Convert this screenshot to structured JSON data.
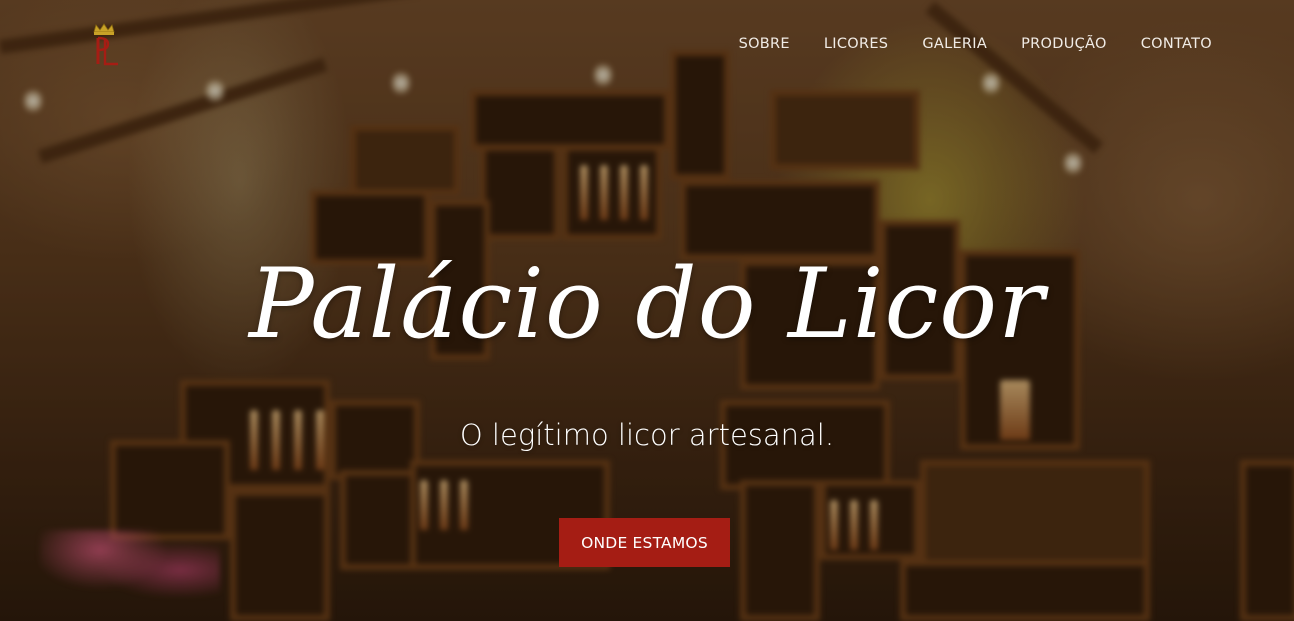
{
  "brand": {
    "logo_icon": "crown-pl-monogram-icon",
    "monogram_letters": "PL",
    "accent_color": "#a51d14"
  },
  "nav": {
    "items": [
      {
        "label": "SOBRE"
      },
      {
        "label": "LICORES"
      },
      {
        "label": "GALERIA"
      },
      {
        "label": "PRODUÇÃO"
      },
      {
        "label": "CONTATO"
      }
    ]
  },
  "hero": {
    "title": "Palácio do Licor",
    "subtitle": "O legítimo licor artesanal.",
    "cta_label": "ONDE ESTAMOS",
    "cta_color": "#a51d14"
  }
}
